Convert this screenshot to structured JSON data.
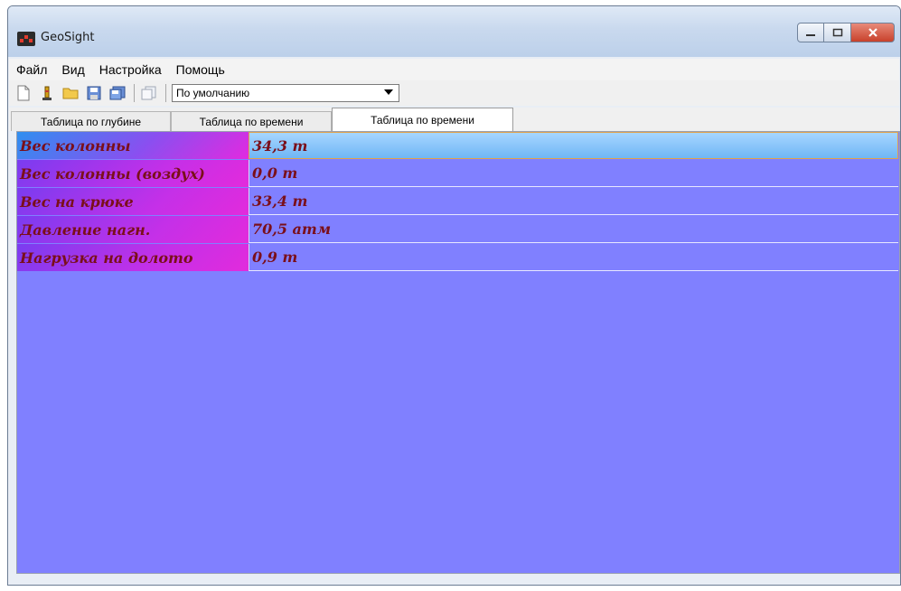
{
  "window": {
    "title": "GeoSight"
  },
  "menu": [
    "Файл",
    "Вид",
    "Настройка",
    "Помощь"
  ],
  "toolbar": {
    "icons": [
      "new-document-icon",
      "tower-icon",
      "open-folder-icon",
      "save-icon",
      "save-all-icon",
      "copy-icon"
    ],
    "profile_select": "По умолчанию"
  },
  "tabs": [
    {
      "label": "Таблица по глубине",
      "active": false
    },
    {
      "label": "Таблица по времени",
      "active": false
    },
    {
      "label": "Таблица по времени",
      "active": true
    }
  ],
  "rows": [
    {
      "label": "Вес колонны",
      "value": "34,3 т"
    },
    {
      "label": "Вес колонны (воздух)",
      "value": "0,0 т"
    },
    {
      "label": "Вес на крюке",
      "value": "33,4 т"
    },
    {
      "label": "Давление нагн.",
      "value": "70,5 атм"
    },
    {
      "label": "Нагрузка на долото",
      "value": "0,9 т"
    }
  ],
  "colors": {
    "panel_background": "#8080ff",
    "text": "#7a0f1a",
    "selected_value": "#8fc8ff"
  }
}
